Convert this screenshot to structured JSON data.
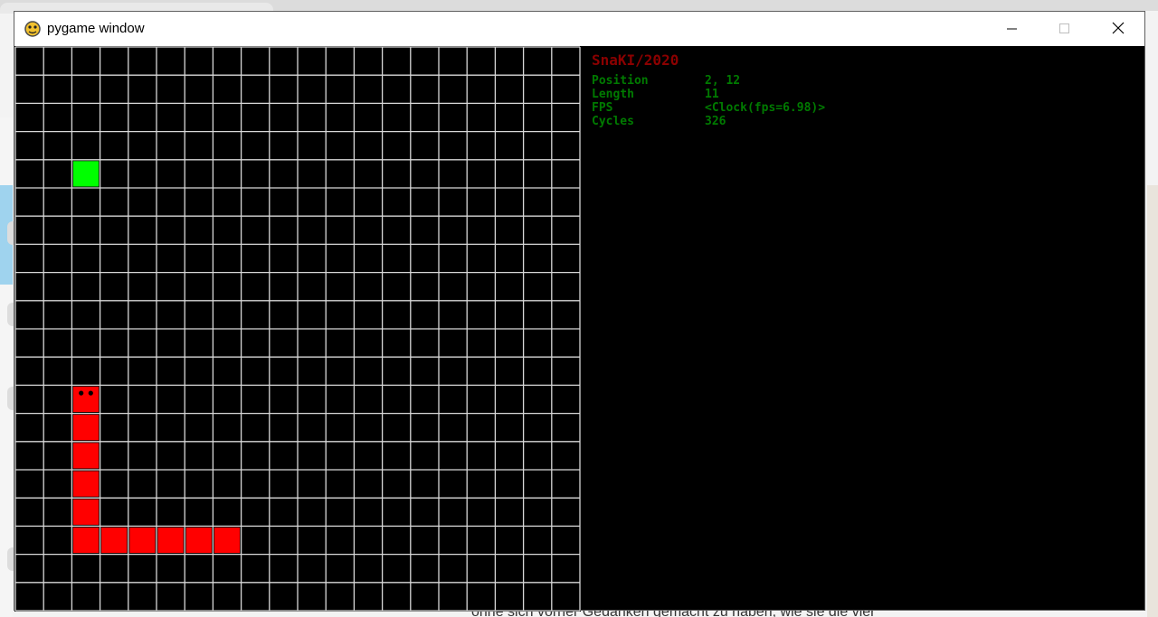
{
  "window": {
    "title": "pygame window",
    "controls": {
      "minimize_icon": "minimize-icon",
      "maximize_icon": "maximize-icon",
      "close_icon": "close-icon"
    }
  },
  "background_text": "ohne sich vorher Gedanken gemacht zu haben, wie sie die vier",
  "game": {
    "grid": {
      "cols": 20,
      "rows": 20
    },
    "colors": {
      "grid_line": "#d8d8d8",
      "snake": "#ff0000",
      "food": "#00ff00",
      "eyes": "#000000",
      "background": "#000000"
    },
    "food": [
      2,
      4
    ],
    "snake": [
      [
        2,
        12
      ],
      [
        2,
        13
      ],
      [
        2,
        14
      ],
      [
        2,
        15
      ],
      [
        2,
        16
      ],
      [
        2,
        17
      ],
      [
        3,
        17
      ],
      [
        4,
        17
      ],
      [
        5,
        17
      ],
      [
        6,
        17
      ],
      [
        7,
        17
      ]
    ],
    "hud": {
      "title": "SnaKI/2020",
      "stats": [
        {
          "label": "Position",
          "value": "2, 12"
        },
        {
          "label": "Length",
          "value": "11"
        },
        {
          "label": "FPS",
          "value": "<Clock(fps=6.98)>"
        },
        {
          "label": "Cycles",
          "value": "326"
        }
      ],
      "title_color": "#8b0000",
      "text_color": "#007a00"
    }
  }
}
